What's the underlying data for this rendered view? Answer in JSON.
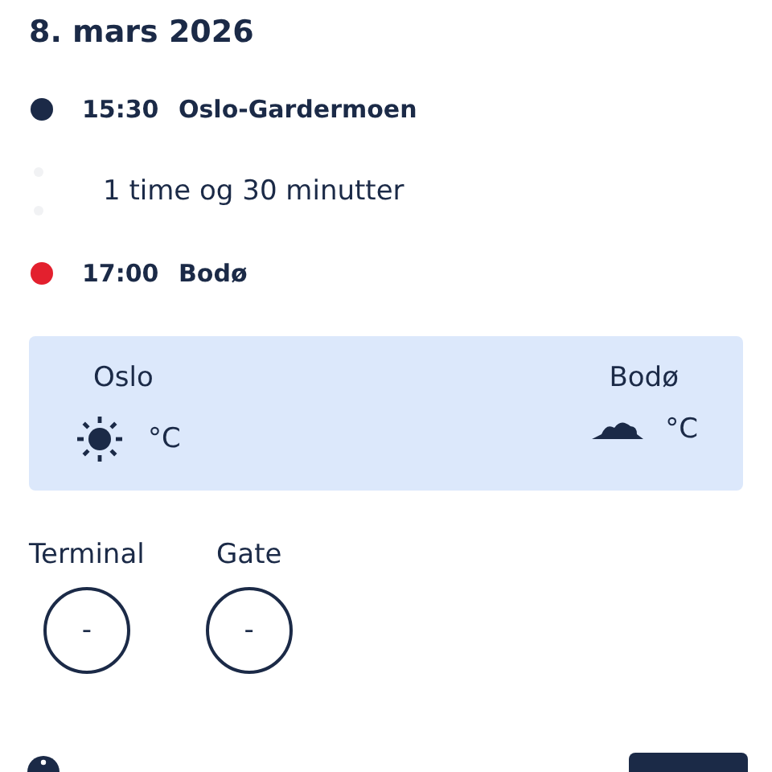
{
  "date": "8. mars 2026",
  "stops": [
    {
      "time": "15:30",
      "place": "Oslo-Gardermoen",
      "color": "#1b2a47"
    },
    {
      "time": "17:00",
      "place": "Bodø",
      "color": "#e3202e"
    }
  ],
  "duration": "1 time og 30 minutter",
  "weather": [
    {
      "city": "Oslo",
      "kind": "sun",
      "unit": "°C"
    },
    {
      "city": "Bodø",
      "kind": "cloud",
      "unit": "°C"
    }
  ],
  "info": [
    {
      "label": "Terminal",
      "value": "-"
    },
    {
      "label": "Gate",
      "value": "-"
    }
  ]
}
